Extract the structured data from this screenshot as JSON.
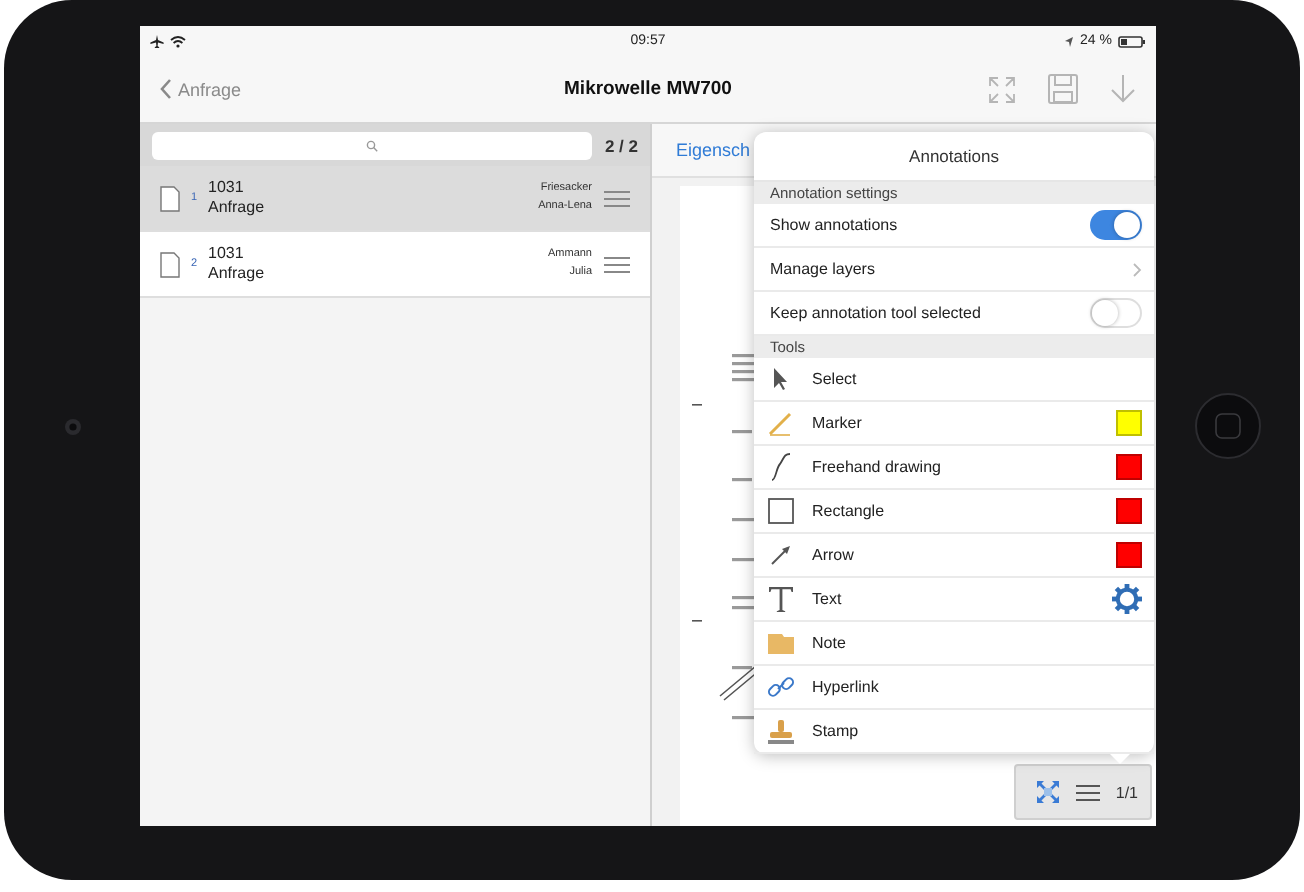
{
  "status_bar": {
    "time": "09:57",
    "battery": "24 %"
  },
  "nav_bar": {
    "back": "Anfrage",
    "title": "Mikrowelle MW700"
  },
  "list": {
    "count": "2 / 2",
    "rows": [
      {
        "number": "1",
        "id": "1031",
        "type": "Anfrage",
        "name_line1": "Friesacker",
        "name_line2": "Anna-Lena",
        "selected": true
      },
      {
        "number": "2",
        "id": "1031",
        "type": "Anfrage",
        "name_line1": "Ammann",
        "name_line2": "Julia",
        "selected": false
      }
    ]
  },
  "detail": {
    "tab": "Eigensch",
    "page_indicator": "1/1"
  },
  "popover": {
    "title": "Annotations",
    "settings_header": "Annotation settings",
    "settings": [
      {
        "kind": "toggle",
        "label": "Show annotations",
        "on": true
      },
      {
        "kind": "link",
        "label": "Manage layers"
      },
      {
        "kind": "toggle",
        "label": "Keep annotation tool selected",
        "on": false
      }
    ],
    "tools_header": "Tools",
    "tools": [
      {
        "kind": "select",
        "label": "Select"
      },
      {
        "kind": "marker",
        "label": "Marker",
        "color": "#ffff00"
      },
      {
        "kind": "freehand",
        "label": "Freehand drawing",
        "color": "#ff0000"
      },
      {
        "kind": "rectangle",
        "label": "Rectangle",
        "color": "#ff0000"
      },
      {
        "kind": "arrow",
        "label": "Arrow",
        "color": "#ff0000"
      },
      {
        "kind": "text",
        "label": "Text"
      },
      {
        "kind": "note",
        "label": "Note"
      },
      {
        "kind": "hyperlink",
        "label": "Hyperlink"
      },
      {
        "kind": "stamp",
        "label": "Stamp"
      }
    ]
  }
}
